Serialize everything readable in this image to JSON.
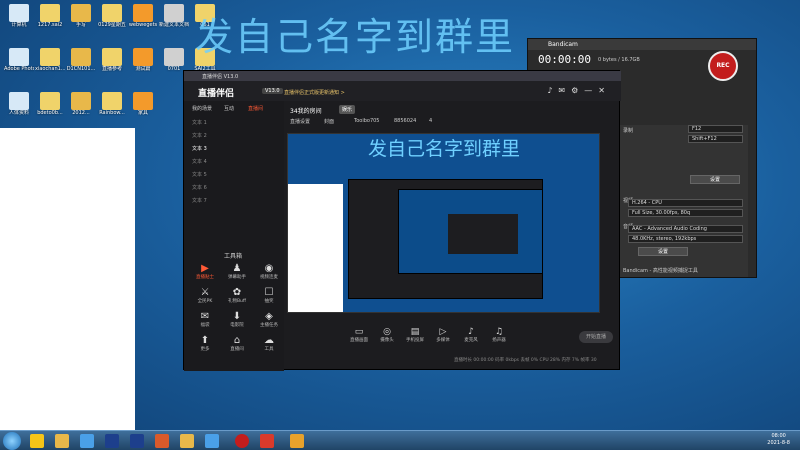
{
  "overlay": {
    "title": "发自己名字到群里"
  },
  "desktop": {
    "icons": [
      {
        "label": "计算机"
      },
      {
        "label": "1217.sai2"
      },
      {
        "label": "手写"
      },
      {
        "label": "0129星期五"
      },
      {
        "label": "webwegets"
      },
      {
        "label": "新建文本文档"
      },
      {
        "label": "061"
      },
      {
        "label": "Adobe Photosh..."
      },
      {
        "label": "xiaochan1..."
      },
      {
        "label": "D1CN101..."
      },
      {
        "label": "直播参考"
      },
      {
        "label": "测试篇"
      },
      {
        "label": "0701"
      },
      {
        "label": "SAI2工具"
      },
      {
        "label": "人体资料"
      },
      {
        "label": "bdeto0b..."
      },
      {
        "label": "2012..."
      },
      {
        "label": "Rainbow..."
      },
      {
        "label": "家具"
      }
    ]
  },
  "bandicam": {
    "title": "Bandicam",
    "time": "00:00:00",
    "size": "0 bytes / 16.7GB",
    "rec_label": "REC",
    "hotkey": "F12",
    "hotkey2": "Shift+F12",
    "settings_label": "设置",
    "video_codec": "H.264 - CPU",
    "video_detail": "Full Size, 30.00fps, 80q",
    "audio_codec": "AAC - Advanced Audio Coding",
    "audio_detail": "48.0KHz, stereo, 192kbps",
    "preset_label": "设置",
    "footer": "Bandicam - 高性能视频捕捉工具",
    "label_hotkey": "录制",
    "label_video": "视频",
    "label_audio": "音频"
  },
  "app": {
    "title": "直播伴侣",
    "window_title": "直播伴侣 V13.0",
    "logo": "直播伴侣",
    "version": "V13.0",
    "notice": "直播伴侣正式版更新通知 >",
    "sidebar_tabs": [
      "我的场景",
      "互动",
      "直播间"
    ],
    "scenes": [
      "文本 1",
      "文本 2",
      "文本 3",
      "文本 4",
      "文本 5",
      "文本 6",
      "文本 7"
    ],
    "active_scene": "文本 3",
    "tools_title": "工具箱",
    "tools": [
      {
        "label": "直播贴士",
        "icon": "▶"
      },
      {
        "label": "弹幕助手",
        "icon": "♟"
      },
      {
        "label": "视频连麦",
        "icon": "◉"
      },
      {
        "label": "全民PK",
        "icon": "⚔"
      },
      {
        "label": "礼物Buff",
        "icon": "✿"
      },
      {
        "label": "抽奖",
        "icon": "☐"
      },
      {
        "label": "福袋",
        "icon": "✉"
      },
      {
        "label": "电影院",
        "icon": "⬇"
      },
      {
        "label": "主播任务",
        "icon": "◈"
      },
      {
        "label": "更多",
        "icon": "⬆"
      },
      {
        "label": "直播间",
        "icon": "⌂"
      },
      {
        "label": "工具",
        "icon": "☁"
      }
    ],
    "room_title": "34我的房间",
    "room_tag": "娱乐",
    "pills": [
      "直播设置",
      "封面",
      "Tooibo705",
      "8856024",
      "4"
    ],
    "preview_text": "发自己名字到群里",
    "bottom_tools": [
      {
        "label": "直播画面",
        "icon": "▭"
      },
      {
        "label": "摄像头",
        "icon": "◎"
      },
      {
        "label": "手机投屏",
        "icon": "▤"
      },
      {
        "label": "多媒体",
        "icon": "▷"
      },
      {
        "label": "麦克风",
        "icon": "♪"
      },
      {
        "label": "扬声器",
        "icon": "♫"
      }
    ],
    "start_label": "开始直播",
    "status": "直播时长 00:00:00   码率 0kbps   丢帧 0%   CPU 28%   内存 7%   帧率 30"
  },
  "taskbar": {
    "time": "08:00",
    "date": "2021-8-8"
  }
}
